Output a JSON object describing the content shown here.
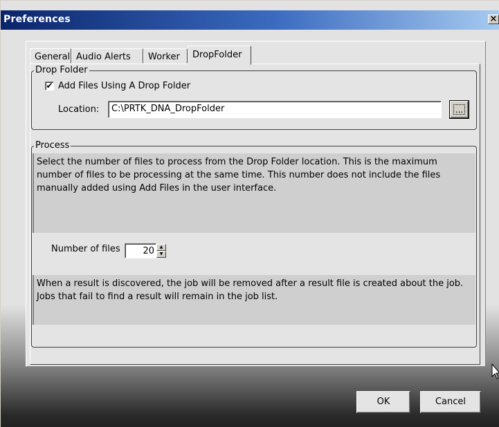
{
  "window": {
    "title": "Preferences",
    "close_glyph": "×"
  },
  "tabs": [
    {
      "label": "General",
      "active": false
    },
    {
      "label": "Audio Alerts",
      "active": false
    },
    {
      "label": "Worker",
      "active": false
    },
    {
      "label": "DropFolder",
      "active": true
    }
  ],
  "drop_folder": {
    "legend": "Drop Folder",
    "checkbox_label": "Add Files Using A Drop Folder",
    "checkbox_checked": true,
    "checkbox_glyph": "✔",
    "location_label": "Location:",
    "location_value": "C:\\PRTK_DNA_DropFolder",
    "browse_label": "..."
  },
  "process": {
    "legend": "Process",
    "description": "Select the number of files to process from the Drop Folder location. This is the maximum number of files to be processing at the same time. This number does not include the files manually added using Add Files in the user interface.",
    "number_label": "Number of files",
    "number_value": "20",
    "note": "When a result is discovered, the job will be removed after a result file is created about the job. Jobs that fail to find a result will remain in the job list."
  },
  "buttons": {
    "ok": "OK",
    "cancel": "Cancel"
  },
  "icons": {
    "close": "close-icon",
    "checkbox": "checkmark-icon",
    "spin_up": "spin-up-icon",
    "spin_down": "spin-down-icon",
    "cursor": "mouse-cursor-icon"
  }
}
